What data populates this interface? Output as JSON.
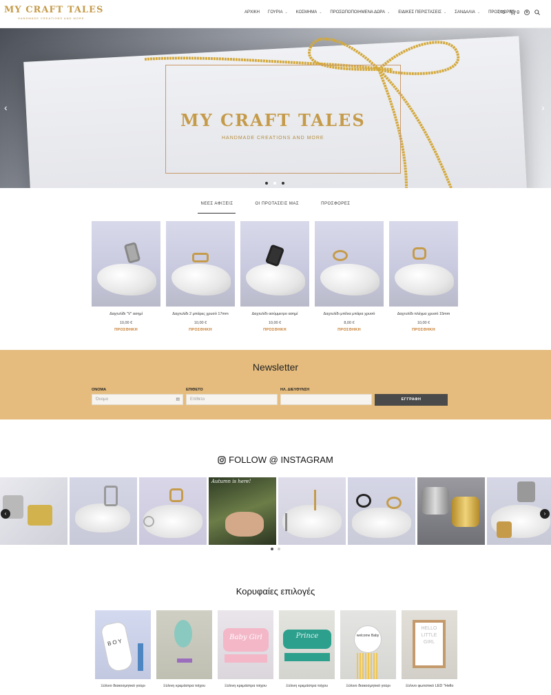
{
  "header": {
    "logo_title": "MY CRAFT TALES",
    "logo_subtitle": "HANDMADE CREATIONS AND MORE",
    "nav": [
      {
        "label": "ΑΡΧΙΚΗ",
        "has_dropdown": false
      },
      {
        "label": "ΓΟΥΡΙΑ",
        "has_dropdown": true
      },
      {
        "label": "ΚΟΣΜΗΜΑ",
        "has_dropdown": true
      },
      {
        "label": "ΠΡΟΣΩΠΟΠΟΙΗΜΕΝΑ ΔΩΡΑ",
        "has_dropdown": true
      },
      {
        "label": "ΕΙΔΙΚΕΣ ΠΕΡΙΣΤΑΣΕΙΣ",
        "has_dropdown": true
      },
      {
        "label": "ΣΑΝΔΑΛΙΑ",
        "has_dropdown": true
      },
      {
        "label": "ΠΡΟΣΦΟΡΕΣ",
        "has_dropdown": true
      }
    ],
    "wishlist_count": "0",
    "cart_count": "0"
  },
  "hero": {
    "title": "MY CRAFT TALES",
    "subtitle": "HANDMADE CREATIONS AND MORE",
    "slide_count": 3,
    "active_slide": 2
  },
  "tabs": [
    {
      "label": "ΝΕΕΣ ΑΦΙΞΕΙΣ",
      "active": true
    },
    {
      "label": "ΟΙ ΠΡΟΤΑΣΕΙΣ ΜΑΣ",
      "active": false
    },
    {
      "label": "ΠΡΟΣΦΟΡΕΣ",
      "active": false
    }
  ],
  "products": [
    {
      "name": "Δαχτυλίδι \"V\" ασημί",
      "price": "10,00 €",
      "add_label": "ΠΡΟΣΘΗΚΗ",
      "ring": "silver"
    },
    {
      "name": "Δαχτυλίδι 2 μπάρες χρυσό 17mm",
      "price": "10,00 €",
      "add_label": "ΠΡΟΣΘΗΚΗ",
      "ring": "gold"
    },
    {
      "name": "Δαχτυλίδι ασύμμετρο ασημί",
      "price": "10,00 €",
      "add_label": "ΠΡΟΣΘΗΚΗ",
      "ring": "black"
    },
    {
      "name": "Δαχτυλίδι μπίλια μπάρα χρυσό",
      "price": "8,00 €",
      "add_label": "ΠΡΟΣΘΗΚΗ",
      "ring": "gold"
    },
    {
      "name": "Δαχτυλίδι πλέγμα χρυσό 15mm",
      "price": "10,00 €",
      "add_label": "ΠΡΟΣΘΗΚΗ",
      "ring": "gold"
    }
  ],
  "newsletter": {
    "title": "Newsletter",
    "first_name_label": "ΟΝΟΜΑ",
    "first_name_placeholder": "Όνομα",
    "last_name_label": "ΕΠΙΘΕΤΟ",
    "last_name_placeholder": "Επίθετο",
    "email_label": "ΗΛ. ΔΙΕΥΘΥΝΣΗ",
    "email_placeholder": "",
    "submit_label": "ΕΓΓΡΑΦΗ"
  },
  "instagram": {
    "title": "FOLLOW @ INSTAGRAM",
    "post_caption": "Autumn is here!",
    "dot_count": 2,
    "active_dot": 1
  },
  "top_picks": {
    "title": "Κορυφαίες επιλογές",
    "items": [
      {
        "name": "Ξύλινο διακοσμητικό γούρι"
      },
      {
        "name": "Ξύλινη κρεμάστρα τοίχου"
      },
      {
        "name": "Ξύλινη κρεμάστρα τοίχου"
      },
      {
        "name": "Ξύλινη κρεμάστρα τοίχου"
      },
      {
        "name": "Ξύλινο διακοσμητικό γούρι"
      },
      {
        "name": "Ξύλινο φωτιστικό LED \"Hello"
      }
    ],
    "decor_text": [
      "BOY",
      "Baby Girl",
      "Prince",
      "welcome Baby",
      "HELLO LITTLE GIRL"
    ]
  },
  "colors": {
    "brand_gold": "#c59b4a",
    "newsletter_bg": "#e5bc7e",
    "add_to_cart": "#c5792a",
    "button_dark": "#4a4a4a"
  }
}
